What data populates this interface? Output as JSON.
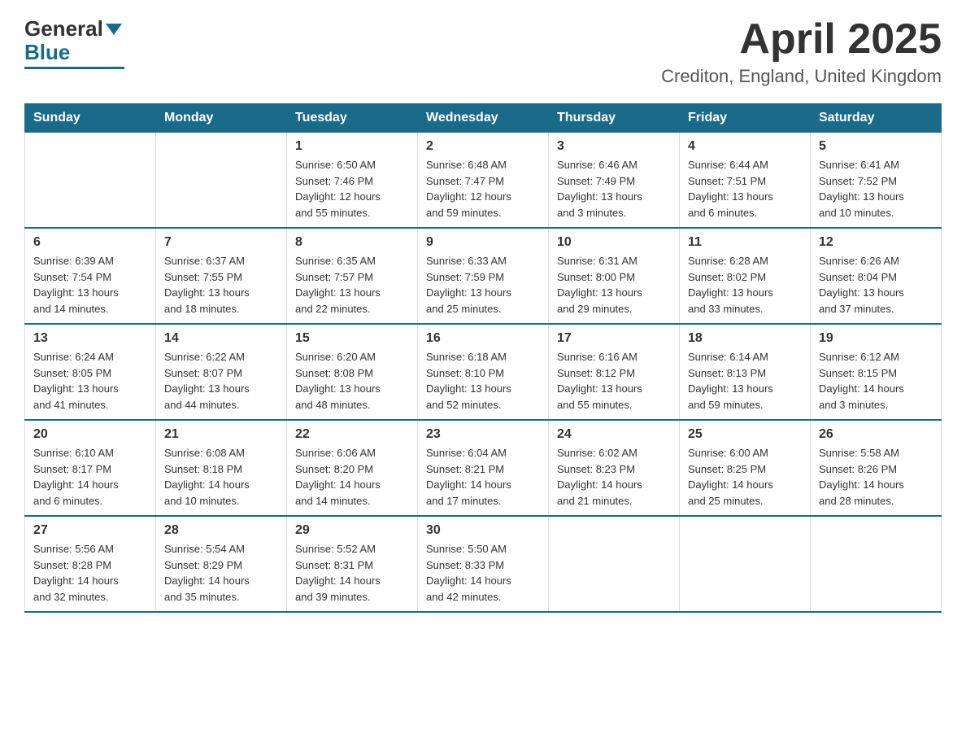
{
  "header": {
    "logo_text_general": "General",
    "logo_text_blue": "Blue",
    "month_title": "April 2025",
    "location": "Crediton, England, United Kingdom"
  },
  "days_of_week": [
    "Sunday",
    "Monday",
    "Tuesday",
    "Wednesday",
    "Thursday",
    "Friday",
    "Saturday"
  ],
  "weeks": [
    [
      {
        "day": "",
        "info": ""
      },
      {
        "day": "",
        "info": ""
      },
      {
        "day": "1",
        "info": "Sunrise: 6:50 AM\nSunset: 7:46 PM\nDaylight: 12 hours\nand 55 minutes."
      },
      {
        "day": "2",
        "info": "Sunrise: 6:48 AM\nSunset: 7:47 PM\nDaylight: 12 hours\nand 59 minutes."
      },
      {
        "day": "3",
        "info": "Sunrise: 6:46 AM\nSunset: 7:49 PM\nDaylight: 13 hours\nand 3 minutes."
      },
      {
        "day": "4",
        "info": "Sunrise: 6:44 AM\nSunset: 7:51 PM\nDaylight: 13 hours\nand 6 minutes."
      },
      {
        "day": "5",
        "info": "Sunrise: 6:41 AM\nSunset: 7:52 PM\nDaylight: 13 hours\nand 10 minutes."
      }
    ],
    [
      {
        "day": "6",
        "info": "Sunrise: 6:39 AM\nSunset: 7:54 PM\nDaylight: 13 hours\nand 14 minutes."
      },
      {
        "day": "7",
        "info": "Sunrise: 6:37 AM\nSunset: 7:55 PM\nDaylight: 13 hours\nand 18 minutes."
      },
      {
        "day": "8",
        "info": "Sunrise: 6:35 AM\nSunset: 7:57 PM\nDaylight: 13 hours\nand 22 minutes."
      },
      {
        "day": "9",
        "info": "Sunrise: 6:33 AM\nSunset: 7:59 PM\nDaylight: 13 hours\nand 25 minutes."
      },
      {
        "day": "10",
        "info": "Sunrise: 6:31 AM\nSunset: 8:00 PM\nDaylight: 13 hours\nand 29 minutes."
      },
      {
        "day": "11",
        "info": "Sunrise: 6:28 AM\nSunset: 8:02 PM\nDaylight: 13 hours\nand 33 minutes."
      },
      {
        "day": "12",
        "info": "Sunrise: 6:26 AM\nSunset: 8:04 PM\nDaylight: 13 hours\nand 37 minutes."
      }
    ],
    [
      {
        "day": "13",
        "info": "Sunrise: 6:24 AM\nSunset: 8:05 PM\nDaylight: 13 hours\nand 41 minutes."
      },
      {
        "day": "14",
        "info": "Sunrise: 6:22 AM\nSunset: 8:07 PM\nDaylight: 13 hours\nand 44 minutes."
      },
      {
        "day": "15",
        "info": "Sunrise: 6:20 AM\nSunset: 8:08 PM\nDaylight: 13 hours\nand 48 minutes."
      },
      {
        "day": "16",
        "info": "Sunrise: 6:18 AM\nSunset: 8:10 PM\nDaylight: 13 hours\nand 52 minutes."
      },
      {
        "day": "17",
        "info": "Sunrise: 6:16 AM\nSunset: 8:12 PM\nDaylight: 13 hours\nand 55 minutes."
      },
      {
        "day": "18",
        "info": "Sunrise: 6:14 AM\nSunset: 8:13 PM\nDaylight: 13 hours\nand 59 minutes."
      },
      {
        "day": "19",
        "info": "Sunrise: 6:12 AM\nSunset: 8:15 PM\nDaylight: 14 hours\nand 3 minutes."
      }
    ],
    [
      {
        "day": "20",
        "info": "Sunrise: 6:10 AM\nSunset: 8:17 PM\nDaylight: 14 hours\nand 6 minutes."
      },
      {
        "day": "21",
        "info": "Sunrise: 6:08 AM\nSunset: 8:18 PM\nDaylight: 14 hours\nand 10 minutes."
      },
      {
        "day": "22",
        "info": "Sunrise: 6:06 AM\nSunset: 8:20 PM\nDaylight: 14 hours\nand 14 minutes."
      },
      {
        "day": "23",
        "info": "Sunrise: 6:04 AM\nSunset: 8:21 PM\nDaylight: 14 hours\nand 17 minutes."
      },
      {
        "day": "24",
        "info": "Sunrise: 6:02 AM\nSunset: 8:23 PM\nDaylight: 14 hours\nand 21 minutes."
      },
      {
        "day": "25",
        "info": "Sunrise: 6:00 AM\nSunset: 8:25 PM\nDaylight: 14 hours\nand 25 minutes."
      },
      {
        "day": "26",
        "info": "Sunrise: 5:58 AM\nSunset: 8:26 PM\nDaylight: 14 hours\nand 28 minutes."
      }
    ],
    [
      {
        "day": "27",
        "info": "Sunrise: 5:56 AM\nSunset: 8:28 PM\nDaylight: 14 hours\nand 32 minutes."
      },
      {
        "day": "28",
        "info": "Sunrise: 5:54 AM\nSunset: 8:29 PM\nDaylight: 14 hours\nand 35 minutes."
      },
      {
        "day": "29",
        "info": "Sunrise: 5:52 AM\nSunset: 8:31 PM\nDaylight: 14 hours\nand 39 minutes."
      },
      {
        "day": "30",
        "info": "Sunrise: 5:50 AM\nSunset: 8:33 PM\nDaylight: 14 hours\nand 42 minutes."
      },
      {
        "day": "",
        "info": ""
      },
      {
        "day": "",
        "info": ""
      },
      {
        "day": "",
        "info": ""
      }
    ]
  ]
}
